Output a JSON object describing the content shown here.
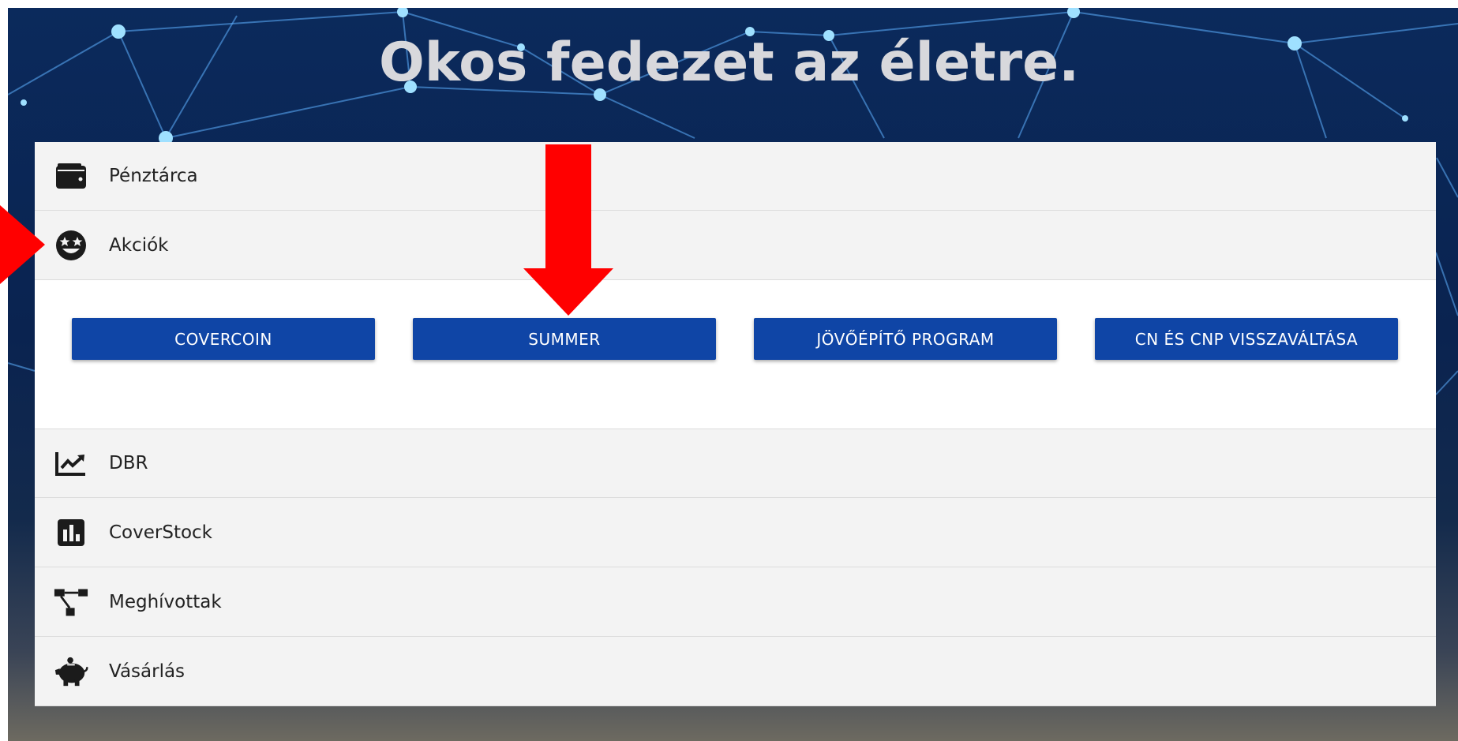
{
  "hero": {
    "title": "Okos fedezet az életre."
  },
  "menu": {
    "items": [
      {
        "label": "Pénztárca",
        "icon": "wallet-icon"
      },
      {
        "label": "Akciók",
        "icon": "star-struck-face-icon"
      },
      {
        "label": "DBR",
        "icon": "chart-line-icon"
      },
      {
        "label": "CoverStock",
        "icon": "bar-chart-icon"
      },
      {
        "label": "Meghívottak",
        "icon": "network-icon"
      },
      {
        "label": "Vásárlás",
        "icon": "piggy-bank-icon"
      }
    ]
  },
  "akciok": {
    "buttons": [
      {
        "label": "COVERCOIN"
      },
      {
        "label": "SUMMER"
      },
      {
        "label": "JÖVŐÉPÍTŐ PROGRAM"
      },
      {
        "label": "CN ÉS CNP VISSZAVÁLTÁSA"
      }
    ]
  },
  "colors": {
    "button": "#0f45a6",
    "annotation_arrow": "#ff0000",
    "panel": "#f3f3f3"
  }
}
